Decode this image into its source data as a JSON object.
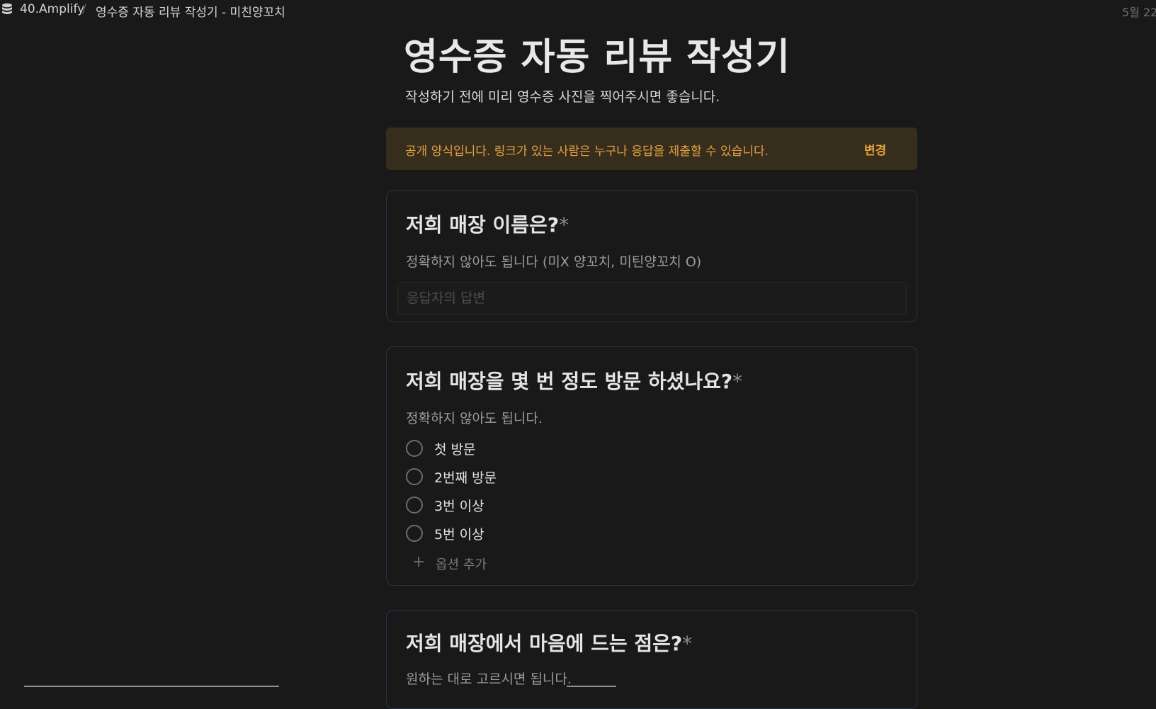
{
  "header": {
    "workspace": "40.Amplify",
    "separator": "/",
    "page": "영수증 자동 리뷰 작성기 - 미친양꼬치",
    "date": "5월 22"
  },
  "form": {
    "title": "영수증 자동 리뷰 작성기",
    "subtitle": "작성하기 전에 미리 영수증 사진을 찍어주시면 좋습니다."
  },
  "notice": {
    "text": "공개 양식입니다. 링크가 있는 사람은 누구나 응답을 제출할 수 있습니다.",
    "action": "변경",
    "color": "#e0a041"
  },
  "questions": [
    {
      "title": "저희 매장 이름은?",
      "required": "*",
      "description": "정확하지 않아도 됩니다 (미X 양꼬치, 미틴양꼬치 O)",
      "placeholder": "응답자의 답변",
      "value": ""
    },
    {
      "title": "저희 매장을 몇 번 정도 방문 하셨나요?",
      "required": "*",
      "description": "정확하지 않아도 됩니다.",
      "options": [
        "첫 방문",
        "2번째 방문",
        "3번 이상",
        "5번 이상"
      ],
      "add_option": "옵션 추가"
    },
    {
      "title": "저희 매장에서 마음에 드는 점은?",
      "required": "*",
      "description": "원하는 대로 고르시면 됩니다."
    }
  ],
  "colors": {
    "background": "#191919",
    "card_border": "#233548",
    "notice_bg": "#372d1d"
  }
}
